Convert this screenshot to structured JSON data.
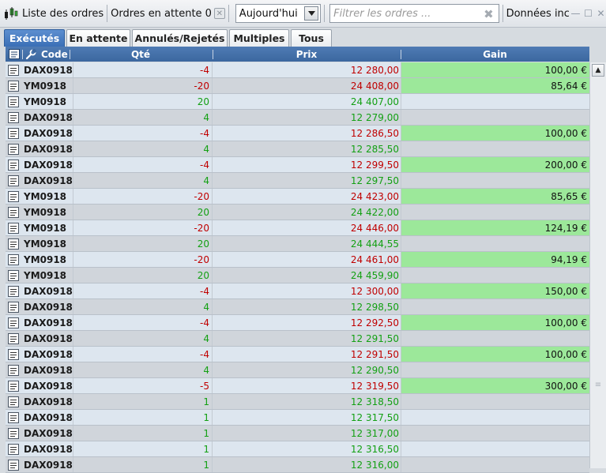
{
  "toolbar": {
    "orders_list_label": "Liste des ordres",
    "pending_label": "Ordres en attente",
    "pending_count": "0",
    "period_selected": "Aujourd'hui",
    "filter_placeholder": "Filtrer les ordres ...",
    "data_label": "Données inc"
  },
  "tabs": [
    {
      "label": "Exécutés",
      "active": true
    },
    {
      "label": "En attente",
      "active": false
    },
    {
      "label": "Annulés/Rejetés",
      "active": false
    },
    {
      "label": "Multiples",
      "active": false
    },
    {
      "label": "Tous",
      "active": false
    }
  ],
  "columns": {
    "code": "Code",
    "qty": "Qté",
    "price": "Prix",
    "gain": "Gain"
  },
  "colors": {
    "negative": "#c00000",
    "positive": "#13a013",
    "gain_bg": "#9ce89a",
    "header_bg": "#3c679f",
    "tab_active": "#3a6fb6"
  },
  "rows": [
    {
      "code": "DAX0918",
      "qty": "-4",
      "price": "12 280,00",
      "gain": "100,00 €"
    },
    {
      "code": "YM0918",
      "qty": "-20",
      "price": "24 408,00",
      "gain": "85,64 €"
    },
    {
      "code": "YM0918",
      "qty": "20",
      "price": "24 407,00",
      "gain": ""
    },
    {
      "code": "DAX0918",
      "qty": "4",
      "price": "12 279,00",
      "gain": ""
    },
    {
      "code": "DAX0918",
      "qty": "-4",
      "price": "12 286,50",
      "gain": "100,00 €"
    },
    {
      "code": "DAX0918",
      "qty": "4",
      "price": "12 285,50",
      "gain": ""
    },
    {
      "code": "DAX0918",
      "qty": "-4",
      "price": "12 299,50",
      "gain": "200,00 €"
    },
    {
      "code": "DAX0918",
      "qty": "4",
      "price": "12 297,50",
      "gain": ""
    },
    {
      "code": "YM0918",
      "qty": "-20",
      "price": "24 423,00",
      "gain": "85,65 €"
    },
    {
      "code": "YM0918",
      "qty": "20",
      "price": "24 422,00",
      "gain": ""
    },
    {
      "code": "YM0918",
      "qty": "-20",
      "price": "24 446,00",
      "gain": "124,19 €"
    },
    {
      "code": "YM0918",
      "qty": "20",
      "price": "24 444,55",
      "gain": ""
    },
    {
      "code": "YM0918",
      "qty": "-20",
      "price": "24 461,00",
      "gain": "94,19 €"
    },
    {
      "code": "YM0918",
      "qty": "20",
      "price": "24 459,90",
      "gain": ""
    },
    {
      "code": "DAX0918",
      "qty": "-4",
      "price": "12 300,00",
      "gain": "150,00 €"
    },
    {
      "code": "DAX0918",
      "qty": "4",
      "price": "12 298,50",
      "gain": ""
    },
    {
      "code": "DAX0918",
      "qty": "-4",
      "price": "12 292,50",
      "gain": "100,00 €"
    },
    {
      "code": "DAX0918",
      "qty": "4",
      "price": "12 291,50",
      "gain": ""
    },
    {
      "code": "DAX0918",
      "qty": "-4",
      "price": "12 291,50",
      "gain": "100,00 €"
    },
    {
      "code": "DAX0918",
      "qty": "4",
      "price": "12 290,50",
      "gain": ""
    },
    {
      "code": "DAX0918",
      "qty": "-5",
      "price": "12 319,50",
      "gain": "300,00 €"
    },
    {
      "code": "DAX0918",
      "qty": "1",
      "price": "12 318,50",
      "gain": ""
    },
    {
      "code": "DAX0918",
      "qty": "1",
      "price": "12 317,50",
      "gain": ""
    },
    {
      "code": "DAX0918",
      "qty": "1",
      "price": "12 317,00",
      "gain": ""
    },
    {
      "code": "DAX0918",
      "qty": "1",
      "price": "12 316,50",
      "gain": ""
    },
    {
      "code": "DAX0918",
      "qty": "1",
      "price": "12 316,00",
      "gain": ""
    }
  ]
}
